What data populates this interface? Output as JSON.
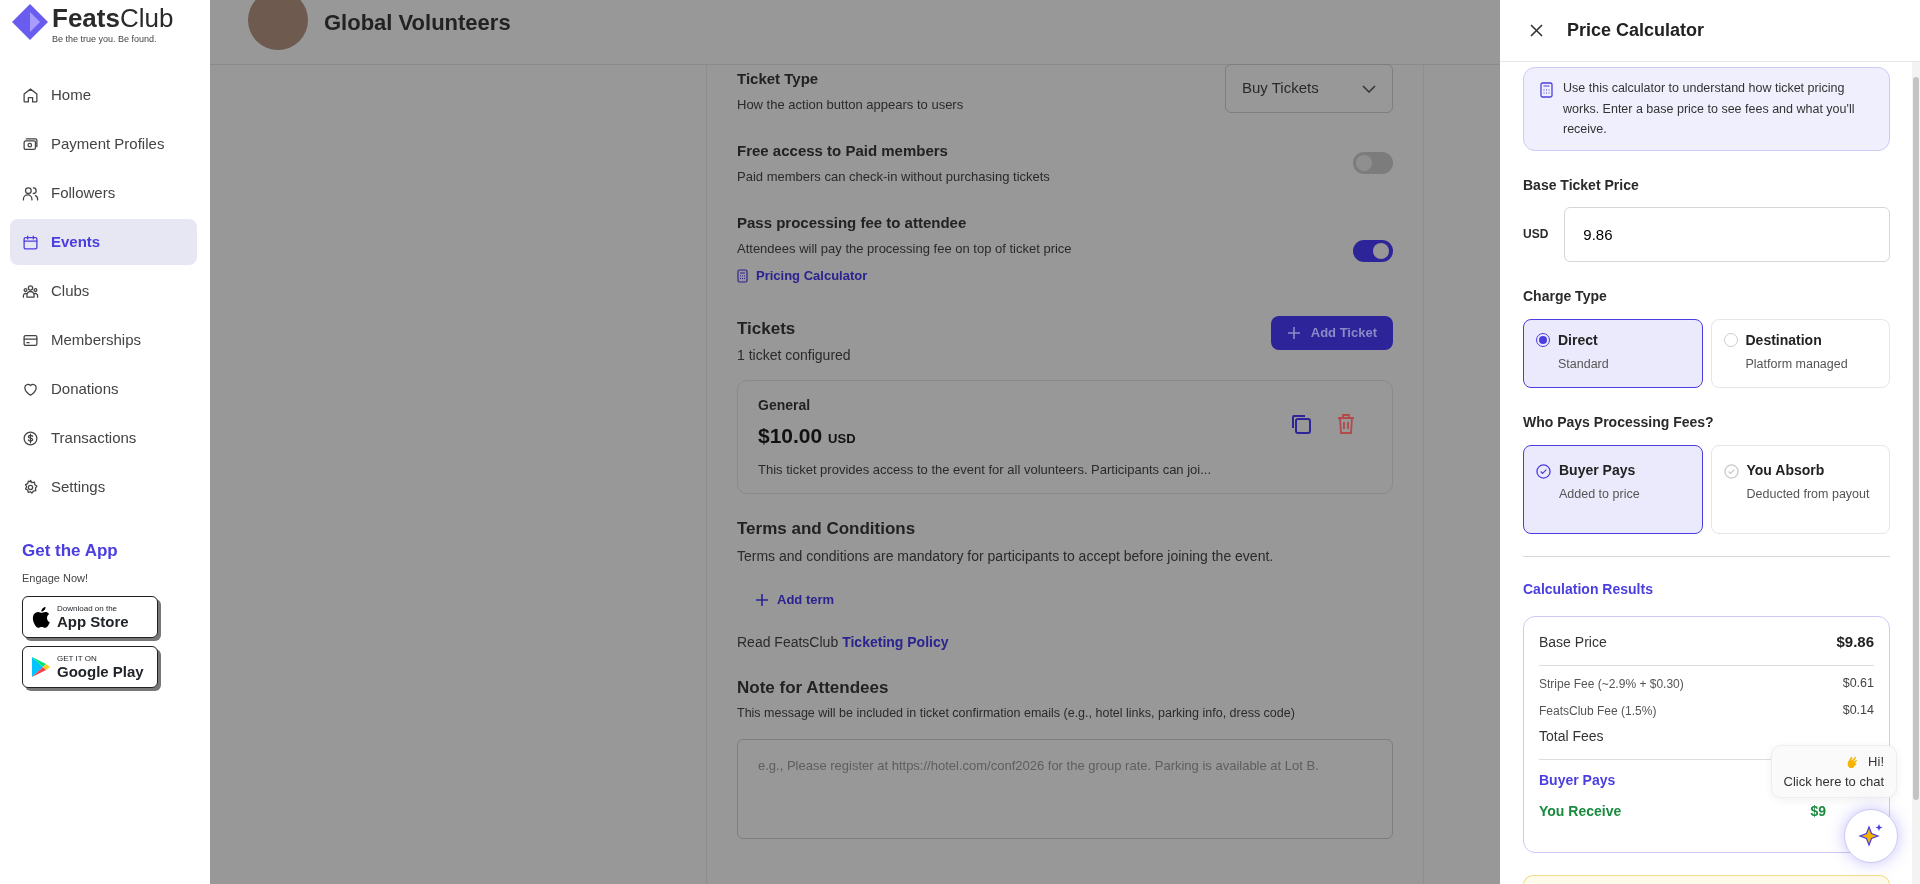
{
  "sidebar": {
    "logo": {
      "name": "**Feats**Club",
      "tagline": "Be the true you. Be found."
    },
    "items": [
      {
        "label": "Home",
        "kind": "home",
        "selected": false
      },
      {
        "label": "Payment Profiles",
        "kind": "wallet",
        "selected": false
      },
      {
        "label": "Followers",
        "kind": "users",
        "selected": false
      },
      {
        "label": "Events",
        "kind": "calendar",
        "selected": true
      },
      {
        "label": "Clubs",
        "kind": "group",
        "selected": false
      },
      {
        "label": "Memberships",
        "kind": "card",
        "selected": false
      },
      {
        "label": "Donations",
        "kind": "heart",
        "selected": false
      },
      {
        "label": "Transactions",
        "kind": "dollar",
        "selected": false
      },
      {
        "label": "Settings",
        "kind": "gear",
        "selected": false
      }
    ],
    "app_promo": {
      "title": "Get the App",
      "subtitle": "Engage Now!",
      "badges": [
        {
          "kind": "apple",
          "small": "Download on the",
          "big": "App Store"
        },
        {
          "kind": "google",
          "small": "GET IT ON",
          "big": "Google Play"
        }
      ]
    }
  },
  "header": {
    "title": "Global Volunteers"
  },
  "settings": [
    {
      "kind": "select",
      "title": "Ticket Type",
      "description": "How the action button appears to users",
      "value": "Buy Tickets"
    },
    {
      "kind": "toggle",
      "title": "Free access to Paid members",
      "description": "Paid members can check-in without purchasing tickets",
      "on": false
    },
    {
      "kind": "toggle",
      "title": "Pass processing fee to attendee",
      "description": "Attendees will pay the processing fee on top of ticket price",
      "on": true,
      "link": "Pricing Calculator"
    }
  ],
  "tickets": {
    "title": "Tickets",
    "count": "1 ticket configured",
    "add_button": "Add Ticket",
    "items": [
      {
        "name": "General",
        "price": "$10.00",
        "currency": "USD",
        "description": "This ticket provides access to the event for all volunteers. Participants can joi..."
      }
    ]
  },
  "terms": {
    "title": "Terms and Conditions",
    "description": "Terms and conditions are mandatory for participants to accept before joining the event.",
    "add_button": "Add term",
    "policy_text": "Read FeatsClub",
    "policy_link": "Ticketing Policy"
  },
  "note": {
    "title": "Note for Attendees",
    "description": "This message will be included in ticket confirmation emails (e.g., hotel links, parking info, dress code)",
    "placeholder": "e.g., Please register at https://hotel.com/conf2026 for the group rate. Parking is available at Lot B."
  },
  "calculator": {
    "title": "Price Calculator",
    "info": "Use this calculator to understand how ticket pricing works. Enter a base price to see fees and what you'll receive.",
    "base_price_label": "Base Ticket Price",
    "currency": "USD",
    "value": "9.86",
    "charge_type": {
      "label": "Charge Type",
      "options": [
        {
          "title": "Direct",
          "subtitle": "Standard",
          "selected": true
        },
        {
          "title": "Destination",
          "subtitle": "Platform managed",
          "selected": false
        }
      ]
    },
    "who_pays": {
      "label": "Who Pays Processing Fees?",
      "options": [
        {
          "title": "Buyer Pays",
          "subtitle": "Added to price",
          "selected": true
        },
        {
          "title": "You Absorb",
          "subtitle": "Deducted from payout",
          "selected": false
        }
      ]
    },
    "results": {
      "title": "Calculation Results",
      "rows": [
        {
          "kind": "base",
          "label": "Base Price",
          "value": "$9.86"
        },
        {
          "kind": "fee",
          "label": "Stripe Fee (~2.9% + $0.30)",
          "value": "$0.61"
        },
        {
          "kind": "fee",
          "label": "FeatsClub Fee (1.5%)",
          "value": "$0.14"
        },
        {
          "kind": "total",
          "label": "Total Fees"
        },
        {
          "kind": "buyer",
          "label": "Buyer Pays"
        },
        {
          "kind": "receive",
          "label": "You Receive",
          "value": "$9"
        }
      ]
    }
  },
  "chat": {
    "greeting": "Hi!",
    "prompt": "Click here to chat"
  }
}
